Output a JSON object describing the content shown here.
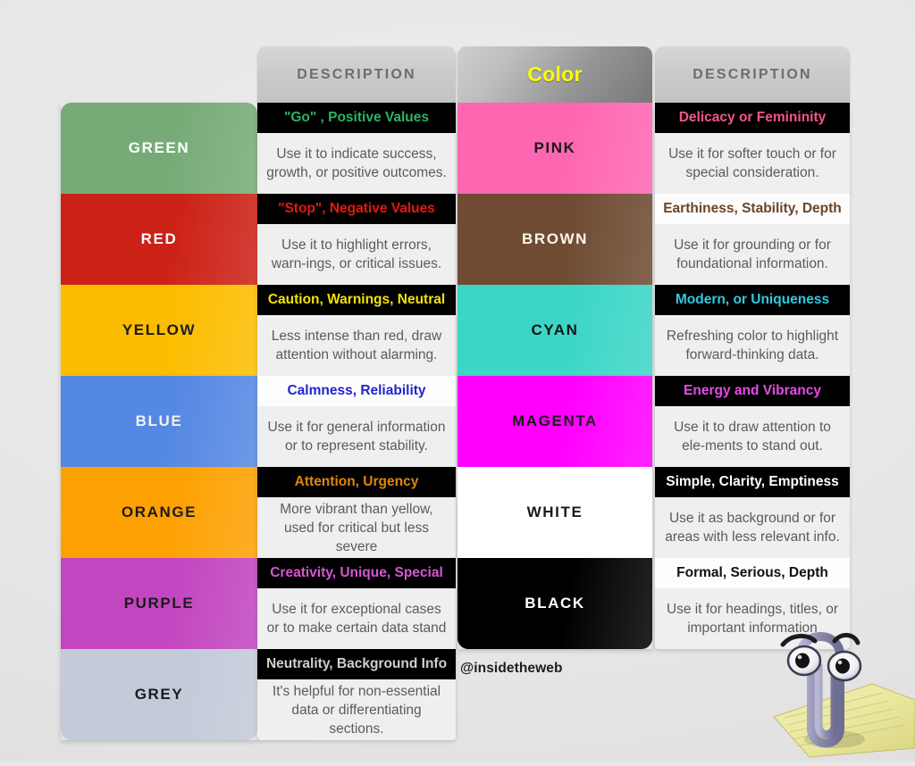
{
  "headers": {
    "desc_left": "DESCRIPTION",
    "color": "Color",
    "desc_right": "DESCRIPTION"
  },
  "watermark": "@insidetheweb",
  "palette": {
    "green": "#76ab77",
    "red": "#cc2116",
    "yellow": "#fcbd00",
    "blue": "#5588e3",
    "orange": "#fda102",
    "purple": "#c246c0",
    "grey": "#c3cad8",
    "pink": "#ff66b2",
    "brown": "#6f4b33",
    "cyan": "#3bd6c6",
    "magenta": "#ff00ff",
    "white": "#ffffff",
    "black": "#000000",
    "header_text": "#6d6d6d",
    "color_header_text": "#ffff00",
    "body_text": "#5b5b5b",
    "body_bg": "#efefef"
  },
  "left_column": [
    {
      "name": "GREEN",
      "swatch_bg": "#76ab77",
      "name_color": "#ffffff",
      "title": "\"Go\" , Positive Values",
      "title_bg": "#000000",
      "title_color": "#2cb268",
      "body": "Use it to indicate success, growth, or positive outcomes."
    },
    {
      "name": "RED",
      "swatch_bg": "#cc2116",
      "name_color": "#ffffff",
      "title": "\"Stop\", Negative Values",
      "title_bg": "#000000",
      "title_color": "#e4180d",
      "body": "Use it to highlight errors, warn-ings, or critical issues."
    },
    {
      "name": "YELLOW",
      "swatch_bg": "#fcbd00",
      "name_color": "#1a1a1a",
      "title": "Caution, Warnings, Neutral",
      "title_bg": "#000000",
      "title_color": "#f2e10c",
      "body": "Less intense than red, draw attention without alarming."
    },
    {
      "name": "BLUE",
      "swatch_bg": "#5588e3",
      "name_color": "#f2f2f2",
      "title": "Calmness, Reliability",
      "title_bg": "#fdfdfd",
      "title_color": "#2323cf",
      "body": "Use it for general information or to represent stability."
    },
    {
      "name": "ORANGE",
      "swatch_bg": "#fda102",
      "name_color": "#1a1a1a",
      "title": "Attention, Urgency",
      "title_bg": "#000000",
      "title_color": "#e1860c",
      "body": "More vibrant than yellow, used for critical but less severe"
    },
    {
      "name": "PURPLE",
      "swatch_bg": "#c246c0",
      "name_color": "#1a1a1a",
      "title": "Creativity, Unique, Special",
      "title_bg": "#000000",
      "title_color": "#d457d2",
      "body": "Use it for exceptional cases or to make certain data stand"
    },
    {
      "name": "GREY",
      "swatch_bg": "#c3cad8",
      "name_color": "#1a1a1a",
      "title": "Neutrality, Background Info",
      "title_bg": "#000000",
      "title_color": "#cfcfcf",
      "body": "It's helpful for non-essential data or differentiating sections."
    }
  ],
  "right_column": [
    {
      "name": "PINK",
      "swatch_bg": "#ff66b2",
      "name_color": "#1a1a1a",
      "title": "Delicacy or Femininity",
      "title_bg": "#000000",
      "title_color": "#f4538f",
      "body": "Use it for softer touch or for special consideration."
    },
    {
      "name": "BROWN",
      "swatch_bg": "#6f4b33",
      "name_color": "#fdf6ea",
      "title": "Earthiness, Stability, Depth",
      "title_bg": "#fdfdfd",
      "title_color": "#6b4327",
      "body": "Use it for grounding or for foundational information."
    },
    {
      "name": "CYAN",
      "swatch_bg": "#3bd6c6",
      "name_color": "#141414",
      "title": "Modern, or Uniqueness",
      "title_bg": "#000000",
      "title_color": "#32c8e0",
      "body": "Refreshing color to highlight forward-thinking data."
    },
    {
      "name": "MAGENTA",
      "swatch_bg": "#ff00ff",
      "name_color": "#1a1a1a",
      "title": "Energy and Vibrancy",
      "title_bg": "#000000",
      "title_color": "#e44ce4",
      "body": "Use it to draw attention to ele-ments to stand out."
    },
    {
      "name": "WHITE",
      "swatch_bg": "#ffffff",
      "name_color": "#1a1a1a",
      "title": "Simple, Clarity, Emptiness",
      "title_bg": "#000000",
      "title_color": "#ffffff",
      "body": "Use it as background or for areas with less relevant info."
    },
    {
      "name": "BLACK",
      "swatch_bg": "#000000",
      "name_color": "#ffffff",
      "title": "Formal, Serious, Depth",
      "title_bg": "#fdfdfd",
      "title_color": "#111111",
      "body": "Use it for headings, titles, or important information"
    }
  ]
}
